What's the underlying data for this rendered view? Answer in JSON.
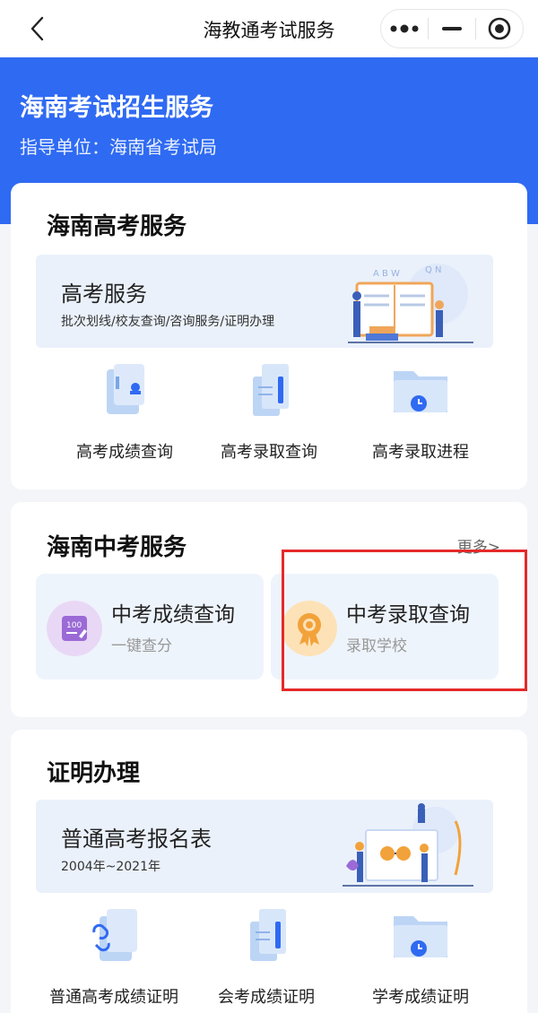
{
  "navbar": {
    "title": "海教通考试服务",
    "back_icon": "chevron-left-icon",
    "more_icon": "more-dots-icon",
    "minimize_icon": "minus-icon",
    "close_icon": "target-circle-icon"
  },
  "hero": {
    "title": "海南考试招生服务",
    "subtitle": "指导单位：海南省考试局",
    "color": "#2f6af2"
  },
  "gaokao": {
    "section_title": "海南高考服务",
    "banner": {
      "title": "高考服务",
      "subtitle": "批次划线/校友查询/咨询服务/证明办理"
    },
    "items": [
      {
        "label": "高考成绩查询",
        "icon": "score-card-icon"
      },
      {
        "label": "高考录取查询",
        "icon": "document-stack-icon"
      },
      {
        "label": "高考录取进程",
        "icon": "folder-clock-icon"
      }
    ]
  },
  "zhongkao": {
    "section_title": "海南中考服务",
    "more_label": "更多>",
    "tiles": [
      {
        "title": "中考成绩查询",
        "subtitle": "一键查分",
        "icon": "score-100-icon",
        "icon_bg": "#e9d8f5"
      },
      {
        "title": "中考录取查询",
        "subtitle": "录取学校",
        "icon": "medal-icon",
        "icon_bg": "#fde2b7"
      }
    ],
    "highlight_color": "#e5292a"
  },
  "certificates": {
    "section_title": "证明办理",
    "banner": {
      "title": "普通高考报名表",
      "subtitle": "2004年~2021年"
    },
    "items": [
      {
        "label": "普通高考成绩证明",
        "icon": "linked-card-icon"
      },
      {
        "label": "会考成绩证明",
        "icon": "document-stack-icon"
      },
      {
        "label": "学考成绩证明",
        "icon": "folder-clock-icon"
      }
    ]
  }
}
